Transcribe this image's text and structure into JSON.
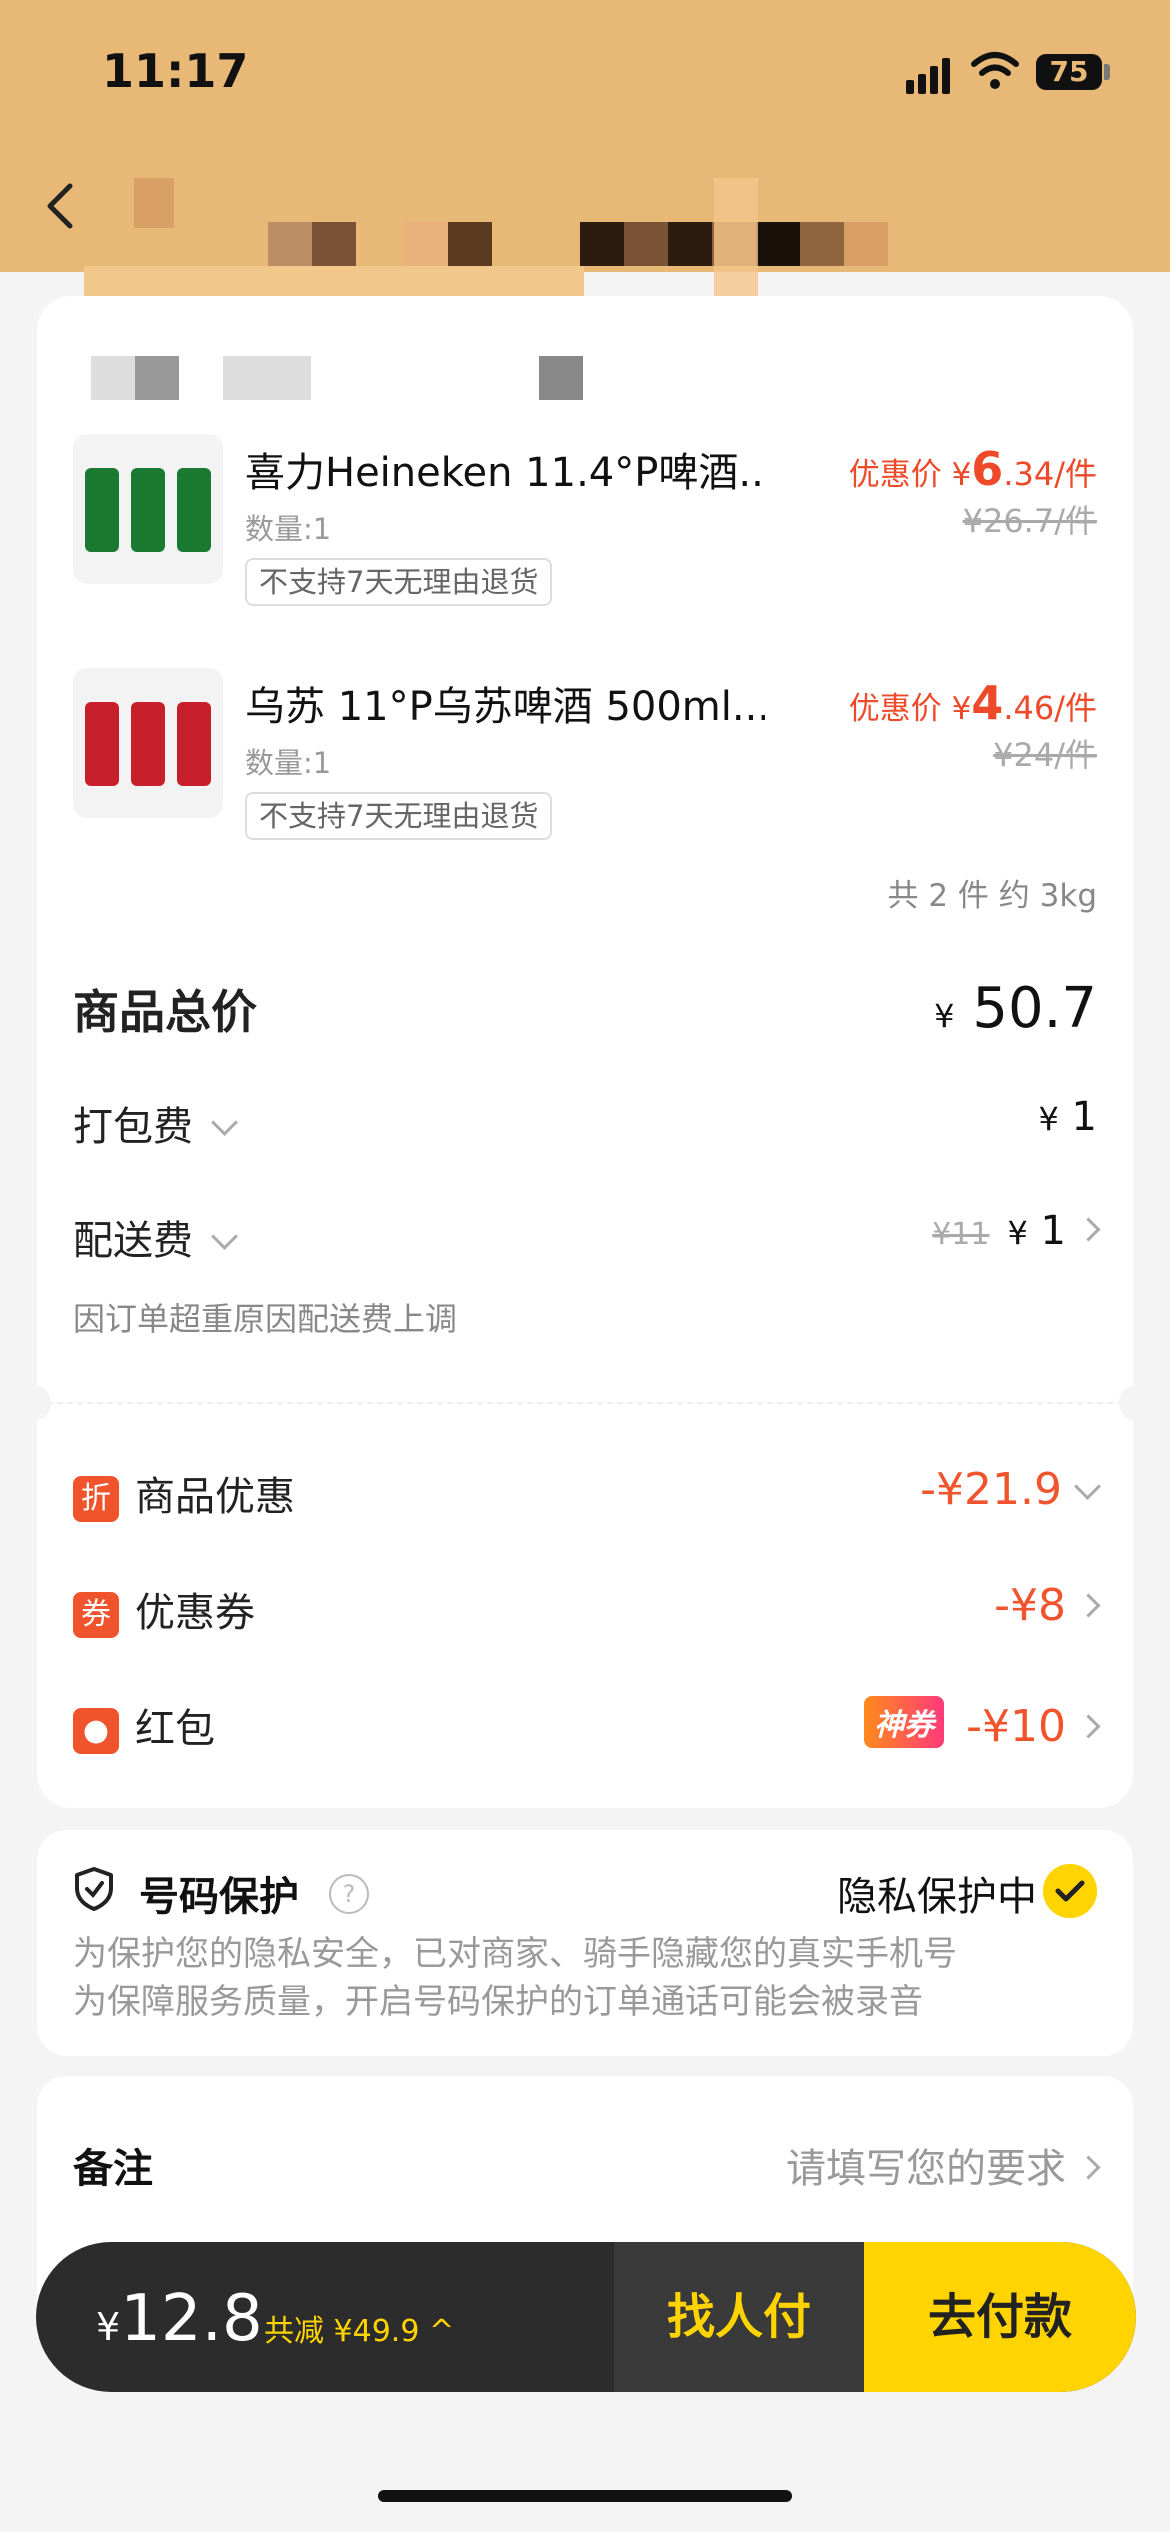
{
  "status": {
    "time": "11:17",
    "battery": "75"
  },
  "products": [
    {
      "name": "喜力Heineken 11.4°P啤酒...",
      "qty": "数量:1",
      "badge": "不支持7天无理由退货",
      "discount_label": "优惠价 ¥",
      "price_main": "6",
      "price_dec": ".34/件",
      "orig_price": "¥26.7/件",
      "can_color": "#1a7a32",
      "image": "heineken-cans"
    },
    {
      "name": "乌苏 11°P乌苏啤酒 500ml...",
      "qty": "数量:1",
      "badge": "不支持7天无理由退货",
      "discount_label": "优惠价 ¥",
      "price_main": "4",
      "price_dec": ".46/件",
      "orig_price": "¥24/件",
      "can_color": "#c8202a",
      "image": "wusu-cans"
    }
  ],
  "summary": "共 2 件  约 3kg",
  "fees": {
    "total_label": "商品总价",
    "total_yen": "¥",
    "total_value": "50.7",
    "packing_label": "打包费",
    "packing_yen": "¥",
    "packing_value": "1",
    "delivery_label": "配送费",
    "delivery_orig": "¥11",
    "delivery_yen": "¥",
    "delivery_value": "1",
    "delivery_note": "因订单超重原因配送费上调"
  },
  "discounts": [
    {
      "icon": "折",
      "label": "商品优惠",
      "value": "-¥21.9"
    },
    {
      "icon": "券",
      "label": "优惠券",
      "value": "-¥8"
    },
    {
      "icon": "",
      "label": "红包",
      "tag": "神券",
      "value": "-¥10"
    }
  ],
  "privacy": {
    "title": "号码保护",
    "help": "?",
    "status": "隐私保护中",
    "line1": "为保护您的隐私安全，已对商家、骑手隐藏您的真实手机号",
    "line2": "为保障服务质量，开启号码保护的订单通话可能会被录音"
  },
  "remark": {
    "label": "备注",
    "placeholder": "请填写您的要求"
  },
  "paybar": {
    "yen": "¥",
    "total": "12.8",
    "saving": "共减 ¥49.9 ^",
    "find_pay": "找人付",
    "pay": "去付款"
  },
  "colors": {
    "header": "#e8b877",
    "accent_red": "#f0542d",
    "accent_yellow": "#ffd400"
  }
}
